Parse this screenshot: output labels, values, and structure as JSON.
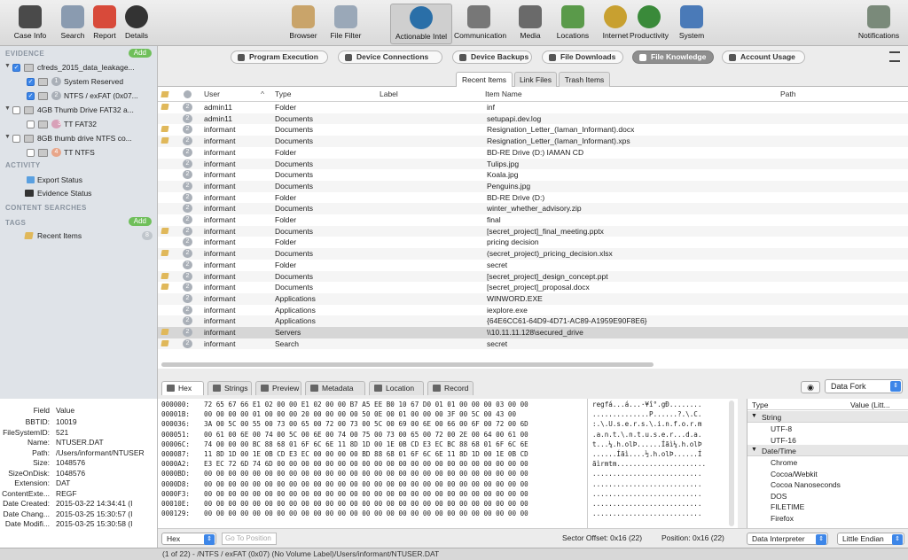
{
  "toolbar": {
    "left": [
      {
        "label": "Case Info",
        "icon": "case-info-icon",
        "color": "#4a4a4a"
      },
      {
        "label": "Search",
        "icon": "magnifier-icon",
        "color": "#8a9bb0"
      },
      {
        "label": "Report",
        "icon": "report-icon",
        "color": "#d84a3a"
      },
      {
        "label": "Details",
        "icon": "gauge-icon",
        "color": "#333333"
      }
    ],
    "center": [
      {
        "label": "Browser",
        "icon": "browser-icon",
        "color": "#c9a46a"
      },
      {
        "label": "File Filter",
        "icon": "funnel-icon",
        "color": "#9aa8b8"
      },
      {
        "label": "Actionable Intel",
        "icon": "globe-icon",
        "color": "#2a6fa8",
        "active": true
      },
      {
        "label": "Communication",
        "icon": "microphone-icon",
        "color": "#777777"
      },
      {
        "label": "Media",
        "icon": "media-icon",
        "color": "#6a6a6a"
      },
      {
        "label": "Locations",
        "icon": "map-icon",
        "color": "#5a9a4a"
      },
      {
        "label": "Internet",
        "icon": "internet-icon",
        "color": "#c8a030"
      },
      {
        "label": "Productivity",
        "icon": "compass-icon",
        "color": "#3a8a3a"
      },
      {
        "label": "System",
        "icon": "system-icon",
        "color": "#4a7ab8"
      }
    ],
    "right": [
      {
        "label": "Notifications",
        "icon": "megaphone-icon",
        "color": "#7a8a7a"
      }
    ]
  },
  "sidebar": {
    "evidence_header": "EVIDENCE",
    "add_label": "Add",
    "evidence": [
      {
        "label": "cfreds_2015_data_leakage...",
        "checked": true,
        "level": 0
      },
      {
        "label": "System Reserved",
        "checked": true,
        "level": 1,
        "badge": "1"
      },
      {
        "label": "NTFS / exFAT (0x07...",
        "checked": true,
        "level": 1,
        "badge": "2"
      },
      {
        "label": "4GB Thumb Drive FAT32 a...",
        "checked": false,
        "level": 0
      },
      {
        "label": "TT FAT32",
        "checked": false,
        "level": 1,
        "badge": "3"
      },
      {
        "label": "8GB thumb drive NTFS co...",
        "checked": false,
        "level": 0
      },
      {
        "label": "TT NTFS",
        "checked": false,
        "level": 1,
        "badge": "4"
      }
    ],
    "activity_header": "ACTIVITY",
    "activity": [
      "Export Status",
      "Evidence Status"
    ],
    "content_header": "CONTENT SEARCHES",
    "tags_header": "TAGS",
    "tags_add": "Add",
    "tags": [
      {
        "label": "Recent Items",
        "count": "8"
      }
    ]
  },
  "tabs": [
    "Program Execution",
    "Device Connections",
    "Device Backups",
    "File Downloads",
    "File Knowledge",
    "Account Usage"
  ],
  "active_tab": "File Knowledge",
  "subtabs": [
    "Recent Items",
    "Link Files",
    "Trash Items"
  ],
  "table": {
    "headers": [
      "User",
      "Type",
      "Label",
      "Item Name",
      "Path"
    ],
    "rows": [
      {
        "tag": true,
        "count": "2",
        "user": "admin11",
        "type": "Folder",
        "name": "inf"
      },
      {
        "tag": false,
        "count": "2",
        "user": "admin11",
        "type": "Documents",
        "name": "setupapi.dev.log"
      },
      {
        "tag": true,
        "count": "2",
        "user": "informant",
        "type": "Documents",
        "name": "Resignation_Letter_(Iaman_Informant).docx"
      },
      {
        "tag": true,
        "count": "2",
        "user": "informant",
        "type": "Documents",
        "name": "Resignation_Letter_(Iaman_Informant).xps"
      },
      {
        "tag": false,
        "count": "2",
        "user": "informant",
        "type": "Folder",
        "name": "BD-RE Drive (D:) IAMAN CD"
      },
      {
        "tag": false,
        "count": "2",
        "user": "informant",
        "type": "Documents",
        "name": "Tulips.jpg"
      },
      {
        "tag": false,
        "count": "2",
        "user": "informant",
        "type": "Documents",
        "name": "Koala.jpg"
      },
      {
        "tag": false,
        "count": "2",
        "user": "informant",
        "type": "Documents",
        "name": "Penguins.jpg"
      },
      {
        "tag": false,
        "count": "2",
        "user": "informant",
        "type": "Folder",
        "name": "BD-RE Drive (D:)"
      },
      {
        "tag": false,
        "count": "2",
        "user": "informant",
        "type": "Documents",
        "name": "winter_whether_advisory.zip"
      },
      {
        "tag": false,
        "count": "2",
        "user": "informant",
        "type": "Folder",
        "name": "final"
      },
      {
        "tag": true,
        "count": "2",
        "user": "informant",
        "type": "Documents",
        "name": "[secret_project]_final_meeting.pptx"
      },
      {
        "tag": false,
        "count": "2",
        "user": "informant",
        "type": "Folder",
        "name": "pricing decision"
      },
      {
        "tag": true,
        "count": "2",
        "user": "informant",
        "type": "Documents",
        "name": "(secret_project)_pricing_decision.xlsx"
      },
      {
        "tag": false,
        "count": "2",
        "user": "informant",
        "type": "Folder",
        "name": "secret"
      },
      {
        "tag": true,
        "count": "2",
        "user": "informant",
        "type": "Documents",
        "name": "[secret_project]_design_concept.ppt"
      },
      {
        "tag": true,
        "count": "2",
        "user": "informant",
        "type": "Documents",
        "name": "[secret_project]_proposal.docx"
      },
      {
        "tag": false,
        "count": "2",
        "user": "informant",
        "type": "Applications",
        "name": "WINWORD.EXE"
      },
      {
        "tag": false,
        "count": "2",
        "user": "informant",
        "type": "Applications",
        "name": "iexplore.exe"
      },
      {
        "tag": false,
        "count": "2",
        "user": "informant",
        "type": "Applications",
        "name": "{64E6CC61-64D9-4D71-AC89-A1959E90F8E6}"
      },
      {
        "tag": true,
        "count": "2",
        "user": "informant",
        "type": "Servers",
        "name": "\\\\10.11.11.128\\secured_drive",
        "selected": true
      },
      {
        "tag": true,
        "count": "2",
        "user": "informant",
        "type": "Search",
        "name": "secret"
      }
    ]
  },
  "bottom_tabs": [
    "Hex",
    "Strings",
    "Preview",
    "Metadata",
    "Location",
    "Record"
  ],
  "data_fork": "Data Fork",
  "properties": {
    "headers": [
      "Field",
      "Value"
    ],
    "rows": [
      {
        "field": "BBTID:",
        "value": "10019"
      },
      {
        "field": "FileSystemID:",
        "value": "521"
      },
      {
        "field": "Name:",
        "value": "NTUSER.DAT"
      },
      {
        "field": "Path:",
        "value": "/Users/informant/NTUSER"
      },
      {
        "field": "Size:",
        "value": "1048576"
      },
      {
        "field": "SizeOnDisk:",
        "value": "1048576"
      },
      {
        "field": "Extension:",
        "value": "DAT"
      },
      {
        "field": "ContentExte...",
        "value": "REGF"
      },
      {
        "field": "Date Created:",
        "value": "2015-03-22 14:34:41 (I"
      },
      {
        "field": "Date Chang...",
        "value": "2015-03-25 15:30:57 (I"
      },
      {
        "field": "Date Modifi...",
        "value": "2015-03-25 15:30:58 (I"
      }
    ]
  },
  "hex": {
    "rows": [
      {
        "addr": "000000:",
        "bytes": "72 65 67 66 E1 02 00 00 E1 02 00 00 B7 A5 EE B0 10 67 D0 01 01 00 00 00 03 00 00",
        "ascii": "regfá...á...·¥î°.gÐ........"
      },
      {
        "addr": "00001B:",
        "bytes": "00 00 00 00 01 00 00 00 20 00 00 00 00 50 0E 00 01 00 00 00 3F 00 5C 00 43 00",
        "ascii": "..............P......?.\\.C."
      },
      {
        "addr": "000036:",
        "bytes": "3A 00 5C 00 55 00 73 00 65 00 72 00 73 00 5C 00 69 00 6E 00 66 00 6F 00 72 00 6D",
        "ascii": ":.\\.U.s.e.r.s.\\.i.n.f.o.r.m"
      },
      {
        "addr": "000051:",
        "bytes": "00 61 00 6E 00 74 00 5C 00 6E 00 74 00 75 00 73 00 65 00 72 00 2E 00 64 00 61 00",
        "ascii": ".a.n.t.\\.n.t.u.s.e.r...d.a."
      },
      {
        "addr": "00006C:",
        "bytes": "74 00 00 00 BC 88 68 01 6F 6C 6E 11 8D 1D 00 1E 0B CD E3 EC BC 88 68 01 6F 6C 6E",
        "ascii": "t...¼.h.olÞ......Íãì¼.h.olÞ"
      },
      {
        "addr": "000087:",
        "bytes": "11 8D 1D 00 1E 0B CD E3 EC 00 00 00 00 BD 88 68 01 6F 6C 6E 11 8D 1D 00 1E 0B CD",
        "ascii": "......Íãì....½.h.olÞ......Í"
      },
      {
        "addr": "0000A2:",
        "bytes": "E3 EC 72 6D 74 6D 00 00 00 00 00 00 00 00 00 00 00 00 00 00 00 00 00 00 00 00 00",
        "ascii": "ãìrmtm......................"
      },
      {
        "addr": "0000BD:",
        "bytes": "00 00 00 00 00 00 00 00 00 00 00 00 00 00 00 00 00 00 00 00 00 00 00 00 00 00 00",
        "ascii": "..........................."
      },
      {
        "addr": "0000D8:",
        "bytes": "00 00 00 00 00 00 00 00 00 00 00 00 00 00 00 00 00 00 00 00 00 00 00 00 00 00 00",
        "ascii": "..........................."
      },
      {
        "addr": "0000F3:",
        "bytes": "00 00 00 00 00 00 00 00 00 00 00 00 00 00 00 00 00 00 00 00 00 00 00 00 00 00 00",
        "ascii": "..........................."
      },
      {
        "addr": "00010E:",
        "bytes": "00 00 00 00 00 00 00 00 00 00 00 00 00 00 00 00 00 00 00 00 00 00 00 00 00 00 00",
        "ascii": "..........................."
      },
      {
        "addr": "000129:",
        "bytes": "00 00 00 00 00 00 00 00 00 00 00 00 00 00 00 00 00 00 00 00 00 00 00 00 00 00 00",
        "ascii": "..........................."
      }
    ],
    "mode": "Hex",
    "goto_placeholder": "Go To Position",
    "sector_offset": "Sector Offset: 0x16 (22)",
    "position": "Position: 0x16 (22)"
  },
  "interpreter": {
    "headers": [
      "Type",
      "Value (Litt..."
    ],
    "groups": [
      {
        "name": "String",
        "items": [
          "UTF-8",
          "UTF-16"
        ]
      },
      {
        "name": "Date/Time",
        "items": [
          "Chrome",
          "Cocoa/Webkit",
          "Cocoa Nanoseconds",
          "DOS",
          "FILETIME",
          "Firefox"
        ]
      }
    ],
    "mode": "Data Interpreter",
    "endian": "Little Endian"
  },
  "status": "(1 of 22) - /NTFS / exFAT (0x07) (No Volume Label)/Users/informant/NTUSER.DAT"
}
